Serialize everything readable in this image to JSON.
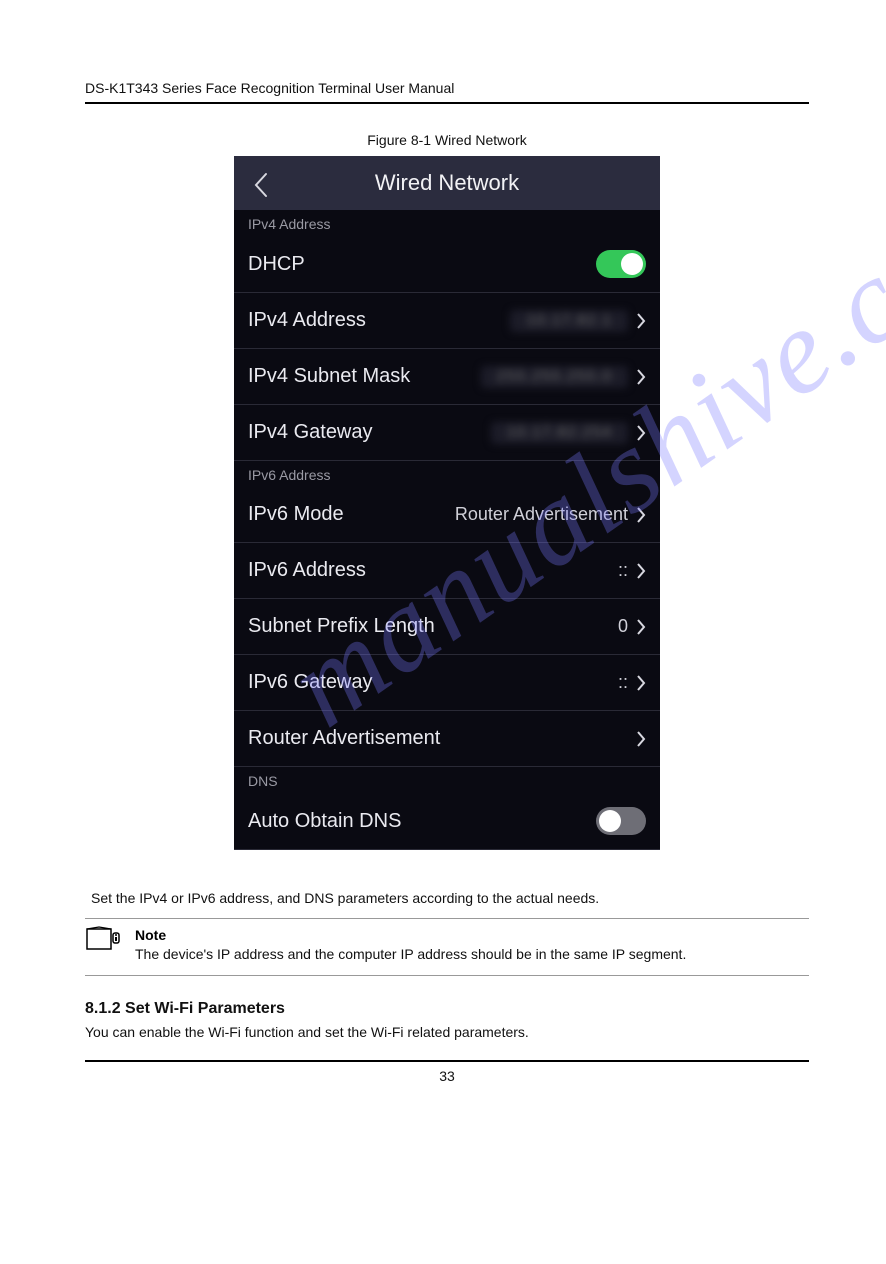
{
  "doc_heading": "DS-K1T343 Series Face Recognition Terminal User Manual",
  "figure_caption": "Figure 8-1 Wired Network",
  "watermark": "manualshive.com",
  "device": {
    "title": "Wired Network",
    "sections": {
      "ipv4": {
        "label": "IPv4 Address",
        "rows": {
          "dhcp": {
            "label": "DHCP"
          },
          "ipv4_address": {
            "label": "IPv4 Address",
            "value": "10.17.82.1"
          },
          "subnet_mask": {
            "label": "IPv4 Subnet Mask",
            "value": "255.255.255.0"
          },
          "gateway": {
            "label": "IPv4 Gateway",
            "value": "10.17.82.254"
          }
        }
      },
      "ipv6": {
        "label": "IPv6 Address",
        "rows": {
          "mode": {
            "label": "IPv6 Mode",
            "value": "Router Advertisement"
          },
          "ipv6_address": {
            "label": "IPv6 Address",
            "value": "::"
          },
          "prefix": {
            "label": "Subnet Prefix Length",
            "value": "0"
          },
          "gateway": {
            "label": "IPv6 Gateway",
            "value": "::"
          },
          "ra": {
            "label": "Router Advertisement"
          }
        }
      },
      "dns": {
        "label": "DNS",
        "rows": {
          "auto_dns": {
            "label": "Auto Obtain DNS"
          }
        }
      }
    }
  },
  "step_text": "Set the IPv4 or IPv6 address, and DNS parameters according to the actual needs.",
  "note_label": "Note",
  "note_text": "The device's IP address and the computer IP address should be in the same IP segment.",
  "subhead": "8.1.2 Set Wi-Fi Parameters",
  "body_text": "You can enable the Wi-Fi function and set the Wi-Fi related parameters.",
  "pagenum": "33"
}
